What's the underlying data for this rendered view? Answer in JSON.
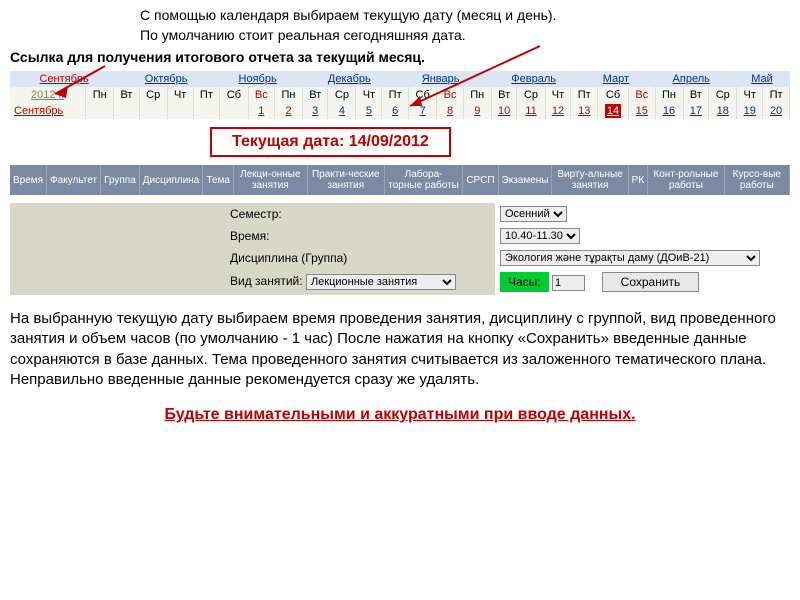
{
  "intro": {
    "line1": "С помощью календаря выбираем текущую дату (месяц и день).",
    "line2": "По умолчанию стоит реальная сегодняшняя дата."
  },
  "subtitle": "Ссылка для получения итогового отчета за текущий месяц.",
  "months": [
    "Сентябрь",
    "Октябрь",
    "Ноябрь",
    "Декабрь",
    "Январь",
    "Февраль",
    "Март",
    "Апрель",
    "Май"
  ],
  "current_month_index": 0,
  "year_label": "2012 г.",
  "month_label": "Сентябрь",
  "weekdays": [
    "Пн",
    "Вт",
    "Ср",
    "Чт",
    "Пт",
    "Сб",
    "Вс"
  ],
  "days_prev_count": 6,
  "days": [
    1,
    2,
    3,
    4,
    5,
    6,
    7,
    8,
    9,
    10,
    11,
    12,
    13,
    14,
    15,
    16,
    17,
    18,
    19,
    20
  ],
  "today": 14,
  "red_days": [
    2,
    9
  ],
  "past_red": [
    9,
    10,
    11,
    12,
    13
  ],
  "datebox": "Текущая дата: 14/09/2012",
  "headers": [
    "Время",
    "Факультет",
    "Группа",
    "Дисциплина",
    "Тема",
    "Лекци-онные занятия",
    "Практи-ческие занятия",
    "Лабора-торные работы",
    "СРСП",
    "Экзамены",
    "Вирту-альные занятия",
    "РК",
    "Конт-рольные работы",
    "Курсо-вые работы"
  ],
  "form": {
    "semester_label": "Семестр:",
    "semester_value": "Осенний",
    "time_label": "Время:",
    "time_value": "10.40-11.30",
    "disc_label": "Дисциплина (Группа)",
    "disc_value": "Экология және тұрақты даму (ДОиВ-21)",
    "type_label": "Вид занятий:",
    "type_value": "Лекционные занятия",
    "hours_label": "Часы:",
    "hours_value": "1",
    "save_button": "Сохранить"
  },
  "body_text": "На выбранную текущую дату выбираем время проведения занятия, дисциплину с группой, вид проведенного занятия и объем часов (по умолчанию - 1 час) После нажатия на кнопку «Сохранить» введенные данные сохраняются в базе данных. Тема проведенного занятия считывается из заложенного тематического плана. Неправильно введенные данные рекомендуется сразу же удалять.",
  "warning": "Будьте внимательными и аккуратными при вводе данных."
}
